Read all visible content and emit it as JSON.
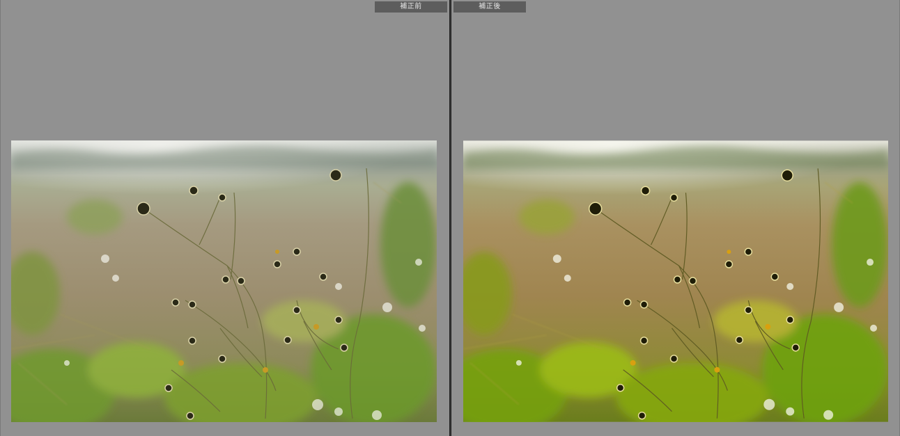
{
  "compare_view": {
    "before": {
      "label": "補正前"
    },
    "after": {
      "label": "補正後"
    }
  },
  "colors": {
    "background": "#8f8f8f",
    "label_bg": "#5d5d5d",
    "divider": "#1f1f1f"
  },
  "icons": {
    "before_photo": "meadow-wildflowers-photo",
    "after_photo": "meadow-wildflowers-photo-adjusted"
  }
}
